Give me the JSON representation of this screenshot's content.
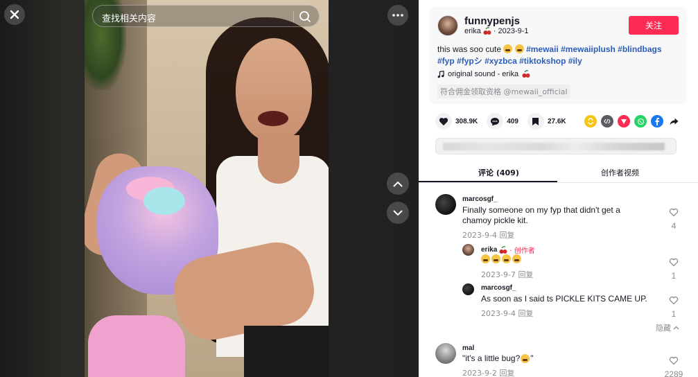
{
  "search": {
    "placeholder": "查找相关内容"
  },
  "video": {
    "description": "woman holding a pink and purple plush blind bag"
  },
  "author": {
    "username": "funnypenjs",
    "nickname": "erika",
    "date": "2023-9-1",
    "follow_label": "关注"
  },
  "post": {
    "text": "this was soo cute",
    "hashtags": [
      "#mewaii",
      "#mewaiiplush",
      "#blindbags",
      "#fyp",
      "#fypシ",
      "#xyzbca",
      "#tiktokshop",
      "#ily"
    ],
    "music": "original sound - erika",
    "commission": "符合佣金领取资格 @mewaii_official"
  },
  "stats": {
    "likes": "308.9K",
    "comments": "409",
    "saves": "27.6K"
  },
  "share_icons": [
    "repost-icon",
    "embed-icon",
    "send-icon",
    "whatsapp-icon",
    "facebook-icon",
    "share-arrow-icon"
  ],
  "tabs": {
    "comments": "评论 (409)",
    "creator_videos": "创作者视频"
  },
  "comments": [
    {
      "user": "marcosgf_",
      "text": "Finally someone on my fyp that didn't get a chamoy pickle kit.",
      "date": "2023-9-4",
      "reply_label": "回复",
      "likes": "4"
    },
    {
      "user": "erika",
      "creator_label": "· 创作者",
      "text": "",
      "date": "2023-9-7",
      "reply_label": "回复",
      "likes": "1"
    },
    {
      "user": "marcosgf_",
      "text": "As soon as I said ts PICKLE KITS CAME UP.",
      "date": "2023-9-4",
      "reply_label": "回复",
      "likes": "1"
    },
    {
      "user": "mal",
      "text": "\"it's a little bug?",
      "text_end": "\"",
      "date": "2023-9-2",
      "reply_label": "回复",
      "likes": "2289"
    }
  ],
  "hide_label": "隐藏",
  "colors": {
    "accent": "#fe2c55",
    "hashtag": "#2b5db9",
    "text": "#161823",
    "muted": "#8a8b91"
  }
}
